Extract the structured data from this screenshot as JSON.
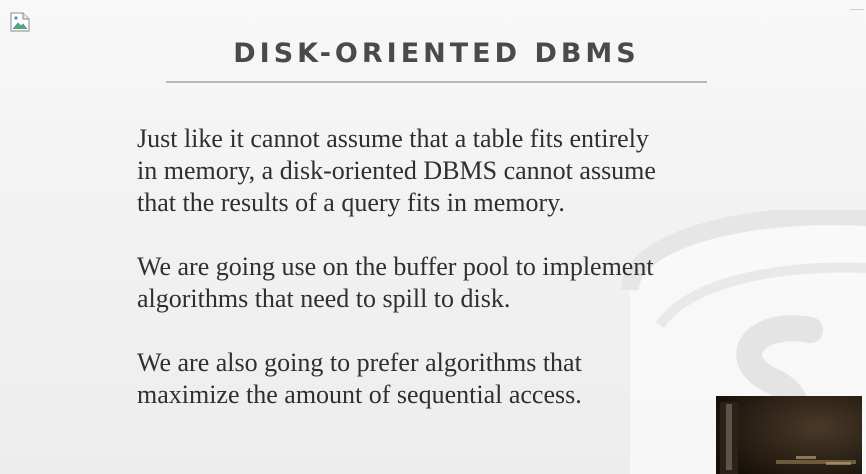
{
  "slide": {
    "title": "DISK-ORIENTED DBMS",
    "paragraphs": [
      {
        "lines": [
          "Just like it cannot assume that a table fits entirely",
          "in memory, a disk-oriented DBMS cannot assume",
          "that the results of a query fits in memory."
        ]
      },
      {
        "lines": [
          "We are going use on the buffer pool to implement",
          "algorithms that need to spill to disk."
        ]
      },
      {
        "lines": [
          "We are also going to prefer algorithms that",
          "maximize the amount of sequential access."
        ]
      }
    ]
  },
  "icons": {
    "broken_image": "broken-image-icon",
    "watermark": "database-logo-watermark"
  },
  "colors": {
    "title": "#4a4a4a",
    "body_text": "#2f2f2f",
    "rule": "#b9b9b9",
    "background": "#f2f2f2"
  }
}
